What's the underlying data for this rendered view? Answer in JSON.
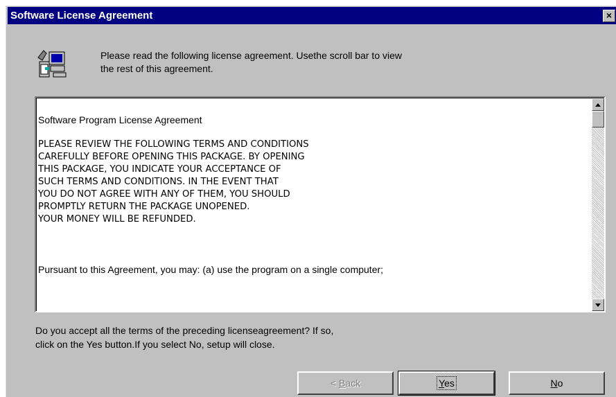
{
  "window": {
    "title": "Software License Agreement",
    "close_label": "×"
  },
  "instruction": {
    "line1": "Please read the following license agreement. Usethe scroll bar to view",
    "line2": "the rest of this agreement."
  },
  "license": {
    "heading": "Software Program License Agreement",
    "terms": [
      "PLEASE REVIEW THE FOLLOWING TERMS AND CONDITIONS",
      "CAREFULLY BEFORE OPENING THIS PACKAGE. BY OPENING",
      "THIS PACKAGE, YOU INDICATE YOUR ACCEPTANCE OF",
      "SUCH TERMS AND CONDITIONS. IN THE EVENT THAT",
      "YOU DO NOT AGREE WITH ANY OF THEM, YOU SHOULD",
      "PROMPTLY RETURN THE PACKAGE UNOPENED.",
      "YOUR MONEY WILL BE REFUNDED."
    ],
    "pursuant": "Pursuant to this Agreement, you may: (a) use the program on a single computer;"
  },
  "question": {
    "line1": "Do you accept all the terms of the preceding licenseagreement? If so,",
    "line2": "click on the Yes button.If you select No, setup will close."
  },
  "buttons": {
    "back": {
      "prefix": "< ",
      "mnemonic": "B",
      "rest": "ack"
    },
    "yes": {
      "prefix": "",
      "mnemonic": "Y",
      "rest": "es"
    },
    "no": {
      "prefix": "",
      "mnemonic": "N",
      "rest": "o"
    }
  },
  "icons": {
    "setup": "computer-setup-icon",
    "close": "close-icon",
    "scroll_up": "chevron-up-icon",
    "scroll_down": "chevron-down-icon"
  },
  "colors": {
    "titlebar": "#000080",
    "face": "#c0c0c0"
  }
}
